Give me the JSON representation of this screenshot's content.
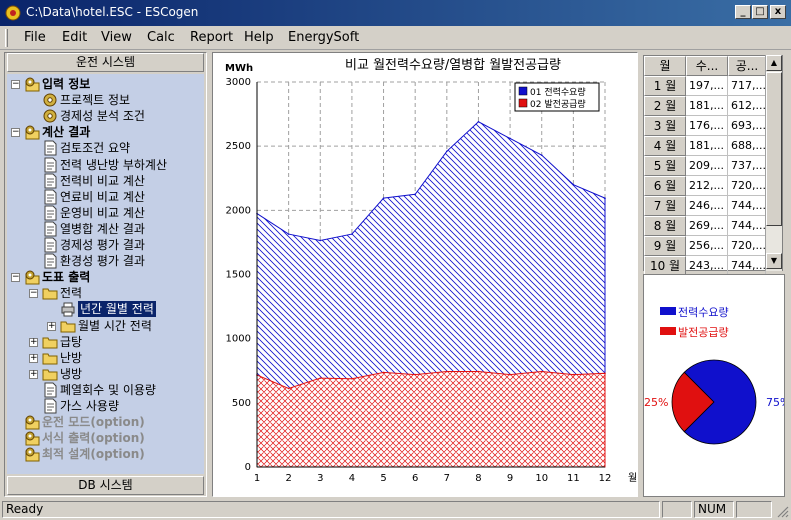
{
  "window": {
    "title": "C:\\Data\\hotel.ESC - ESCogen",
    "min": "_",
    "max": "□",
    "close": "x"
  },
  "menu": [
    "File",
    "Edit",
    "View",
    "Calc",
    "Report",
    "Help",
    "EnergySoft"
  ],
  "left_panel": {
    "top_header": "운전 시스템",
    "bottom_header": "DB 시스템",
    "tree": [
      {
        "label": "입력 정보",
        "level": 0,
        "pm": "-",
        "style": "bold",
        "icon": "gear-folder-icon"
      },
      {
        "label": "프로젝트 정보",
        "level": 1,
        "pm": "",
        "style": "",
        "icon": "gear-icon"
      },
      {
        "label": "경제성 분석 조건",
        "level": 1,
        "pm": "",
        "style": "",
        "icon": "gear-icon"
      },
      {
        "label": "계산 결과",
        "level": 0,
        "pm": "-",
        "style": "bold",
        "icon": "gear-folder-icon"
      },
      {
        "label": "검토조건 요약",
        "level": 1,
        "pm": "",
        "style": "",
        "icon": "document-icon"
      },
      {
        "label": "전력 냉난방 부하계산",
        "level": 1,
        "pm": "",
        "style": "",
        "icon": "document-icon"
      },
      {
        "label": "전력비 비교 계산",
        "level": 1,
        "pm": "",
        "style": "",
        "icon": "document-icon"
      },
      {
        "label": "연료비 비교 계산",
        "level": 1,
        "pm": "",
        "style": "",
        "icon": "document-icon"
      },
      {
        "label": "운영비 비교 계산",
        "level": 1,
        "pm": "",
        "style": "",
        "icon": "document-icon"
      },
      {
        "label": "열병합 계산 결과",
        "level": 1,
        "pm": "",
        "style": "",
        "icon": "document-icon"
      },
      {
        "label": "경제성 평가 결과",
        "level": 1,
        "pm": "",
        "style": "",
        "icon": "document-icon"
      },
      {
        "label": "환경성 평가 결과",
        "level": 1,
        "pm": "",
        "style": "",
        "icon": "document-icon"
      },
      {
        "label": "도표 출력",
        "level": 0,
        "pm": "-",
        "style": "bold",
        "icon": "gear-folder-icon"
      },
      {
        "label": "전력",
        "level": 1,
        "pm": "-",
        "style": "",
        "icon": "folder-icon"
      },
      {
        "label": "년간 월별 전력",
        "level": 2,
        "pm": "",
        "style": "sel",
        "icon": "printer-icon"
      },
      {
        "label": "월별 시간 전력",
        "level": 2,
        "pm": "+",
        "style": "",
        "icon": "folder-icon"
      },
      {
        "label": "급탕",
        "level": 1,
        "pm": "+",
        "style": "",
        "icon": "folder-icon"
      },
      {
        "label": "난방",
        "level": 1,
        "pm": "+",
        "style": "",
        "icon": "folder-icon"
      },
      {
        "label": "냉방",
        "level": 1,
        "pm": "+",
        "style": "",
        "icon": "folder-icon"
      },
      {
        "label": "폐열회수 및 이용량",
        "level": 1,
        "pm": "",
        "style": "",
        "icon": "document-icon"
      },
      {
        "label": "가스 사용량",
        "level": 1,
        "pm": "",
        "style": "",
        "icon": "document-icon"
      },
      {
        "label": "운전 모드(option)",
        "level": 0,
        "pm": "",
        "style": "gray",
        "icon": "gear-folder-icon"
      },
      {
        "label": "서식 출력(option)",
        "level": 0,
        "pm": "",
        "style": "gray",
        "icon": "gear-folder-icon"
      },
      {
        "label": "최적 설계(option)",
        "level": 0,
        "pm": "",
        "style": "gray",
        "icon": "gear-folder-icon"
      }
    ]
  },
  "table": {
    "headers": [
      "월",
      "수...",
      "공..."
    ],
    "rows": [
      [
        "1 월",
        "197,...",
        "717,..."
      ],
      [
        "2 월",
        "181,...",
        "612,..."
      ],
      [
        "3 월",
        "176,...",
        "693,..."
      ],
      [
        "4 월",
        "181,...",
        "688,..."
      ],
      [
        "5 월",
        "209,...",
        "737,..."
      ],
      [
        "6 월",
        "212,...",
        "720,..."
      ],
      [
        "7 월",
        "246,...",
        "744,..."
      ],
      [
        "8 월",
        "269,...",
        "744,..."
      ],
      [
        "9 월",
        "256,...",
        "720,..."
      ],
      [
        "10 월",
        "243,...",
        "744,..."
      ]
    ]
  },
  "status": {
    "text": "Ready",
    "num": "NUM"
  },
  "colors": {
    "demand": "#1010cc",
    "supply": "#e01010",
    "tree_bg": "#c4cfe6",
    "selection": "#0a246a"
  },
  "chart_data": [
    {
      "type": "area",
      "title": "비교 월전력수요량/열병합 월발전공급량",
      "ylabel": "MWh",
      "xlabel": "월",
      "x": [
        1,
        2,
        3,
        4,
        5,
        6,
        7,
        8,
        9,
        10,
        11,
        12
      ],
      "ylim": [
        0,
        3000
      ],
      "yticks": [
        0,
        500,
        1000,
        1500,
        2000,
        2500,
        3000
      ],
      "grid": true,
      "legend_position": "top-right",
      "series": [
        {
          "name": "01 전력수요량",
          "color": "#1010cc",
          "values": [
            1975,
            1815,
            1765,
            1815,
            2095,
            2125,
            2460,
            2690,
            2560,
            2430,
            2200,
            2095
          ]
        },
        {
          "name": "02 발전공급량",
          "color": "#e01010",
          "values": [
            717,
            612,
            693,
            688,
            737,
            720,
            744,
            744,
            720,
            744,
            720,
            730
          ]
        }
      ]
    },
    {
      "type": "pie",
      "categories": [
        "전력수요량",
        "발전공급량"
      ],
      "values": [
        75,
        25
      ],
      "labels": [
        "75%",
        "25%"
      ],
      "colors": [
        "#1010cc",
        "#e01010"
      ]
    }
  ]
}
